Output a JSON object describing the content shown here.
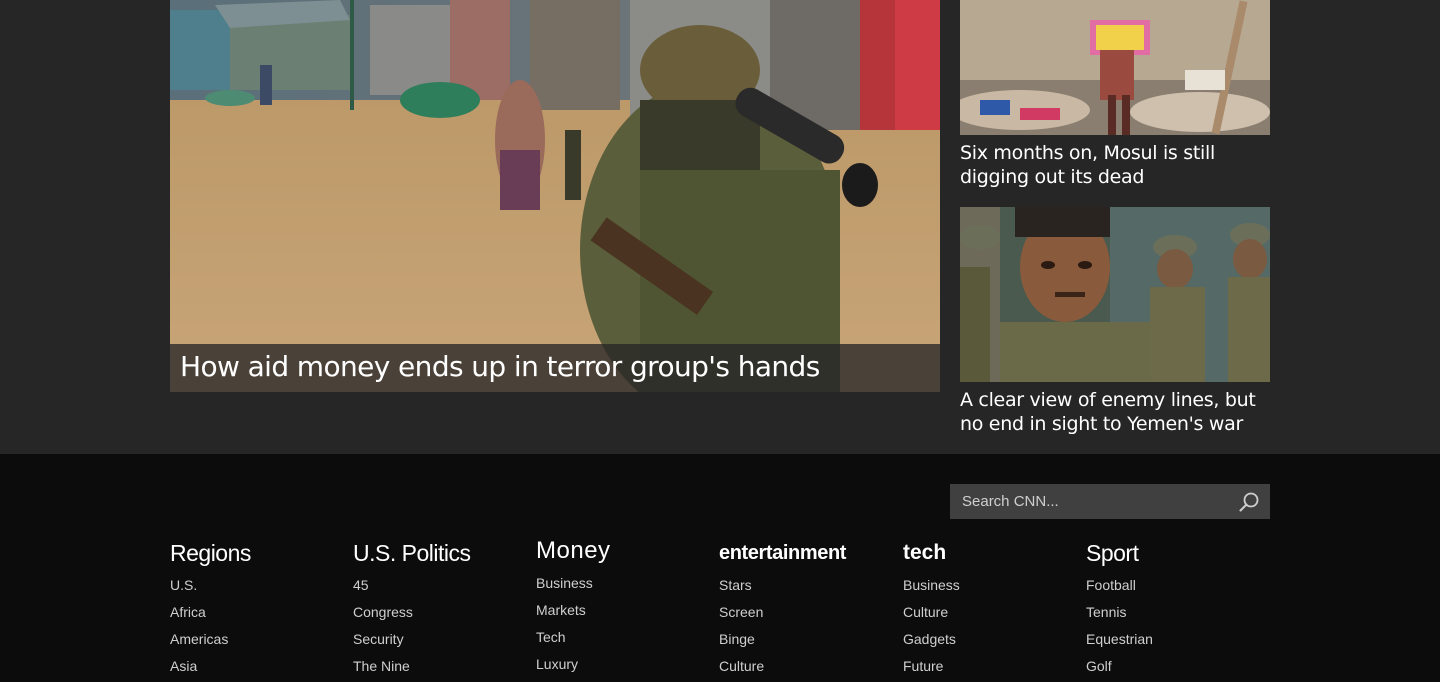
{
  "main_story": {
    "headline": "How aid money ends up in terror group's hands",
    "image_icon": "soldier-photo"
  },
  "side_stories": [
    {
      "headline": "Six months on, Mosul is still digging out its dead",
      "image_icon": "rubble-child-photo"
    },
    {
      "headline": "A clear view of enemy lines, but no end in sight to Yemen's war",
      "image_icon": "soldiers-photo"
    }
  ],
  "footer": {
    "search": {
      "placeholder": "Search CNN...",
      "value": ""
    },
    "columns": [
      {
        "title": "Regions",
        "links": [
          "U.S.",
          "Africa",
          "Americas",
          "Asia"
        ]
      },
      {
        "title": "U.S. Politics",
        "links": [
          "45",
          "Congress",
          "Security",
          "The Nine"
        ]
      },
      {
        "title": "Money",
        "links": [
          "Business",
          "Markets",
          "Tech",
          "Luxury"
        ]
      },
      {
        "title": "entertainment",
        "links": [
          "Stars",
          "Screen",
          "Binge",
          "Culture"
        ]
      },
      {
        "title": "tech",
        "links": [
          "Business",
          "Culture",
          "Gadgets",
          "Future"
        ]
      },
      {
        "title": "Sport",
        "links": [
          "Football",
          "Tennis",
          "Equestrian",
          "Golf"
        ]
      }
    ]
  },
  "colors": {
    "page_background": "#262626",
    "footer_background": "#0c0c0c",
    "search_background": "#404040",
    "text_primary": "#ffffff",
    "text_link": "#cfcfcf"
  }
}
